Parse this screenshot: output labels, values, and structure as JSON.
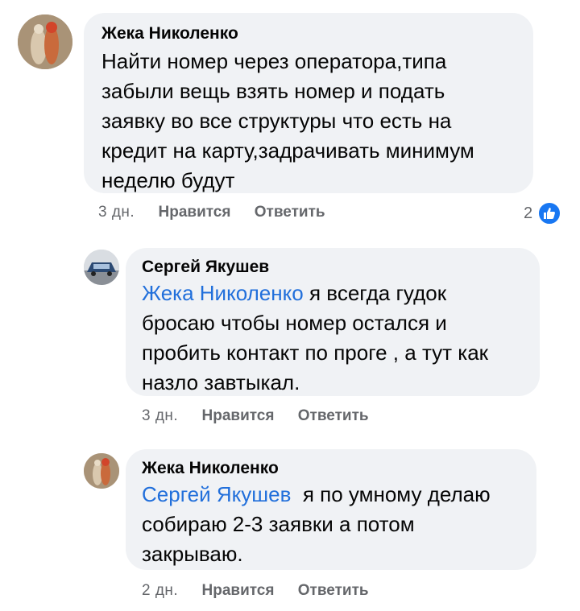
{
  "comments": [
    {
      "author": "Жека Николенко",
      "lines": [
        "Найти номер через оператора,типа",
        "забыли вещь взять номер и подать",
        "заявку во все структуры что есть на",
        "кредит на карту,задрачивать минимум",
        "неделю будут"
      ],
      "time": "3 дн.",
      "like_label": "Нравится",
      "reply_label": "Ответить",
      "reaction_count": "2",
      "reaction_icon": "like-icon"
    },
    {
      "author": "Сергей Якушев",
      "mention": "Жека Николенко",
      "lines": [
        " я всегда гудок",
        "бросаю чтобы номер остался и",
        "пробить контакт по проге , а тут как",
        "назло завтыкал."
      ],
      "time": "3 дн.",
      "like_label": "Нравится",
      "reply_label": "Ответить"
    },
    {
      "author": "Жека Николенко",
      "mention": "Сергей Якушев",
      "lines": [
        "  я по умному делаю",
        "собираю 2-3 заявки а потом",
        "закрываю."
      ],
      "time": "2 дн.",
      "like_label": "Нравится",
      "reply_label": "Ответить"
    }
  ],
  "colors": {
    "bubble": "#f0f2f5",
    "mention": "#216fdb",
    "meta": "#65676b",
    "like": "#1877f2"
  }
}
